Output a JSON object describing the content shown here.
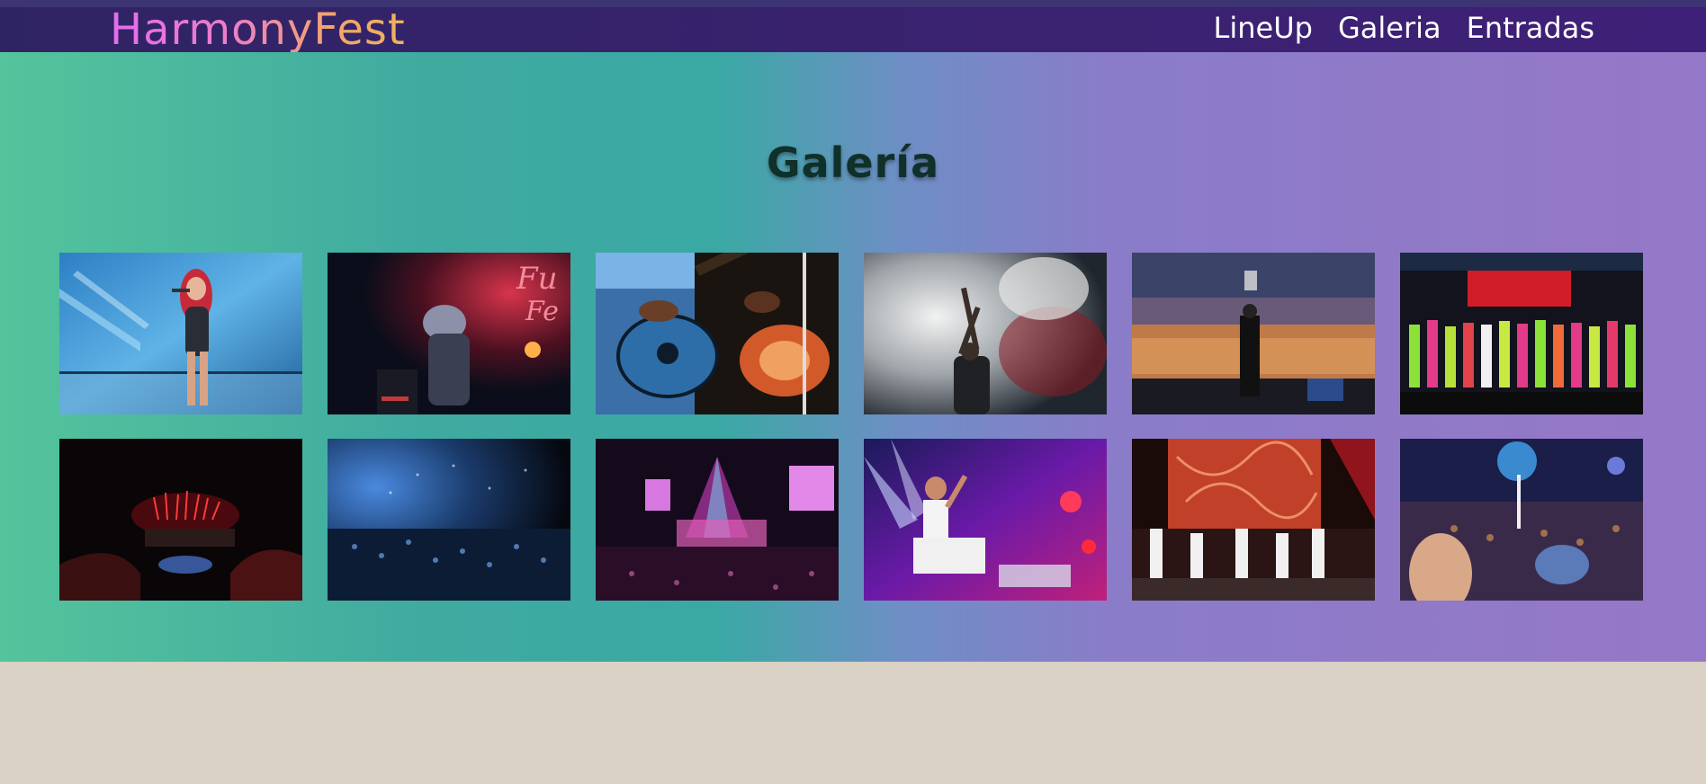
{
  "navbar": {
    "logo": "HarmonyFest",
    "links": [
      "LineUp",
      "Galeria",
      "Entradas"
    ]
  },
  "gallery": {
    "title": "Galería",
    "photos": [
      "singer-red-hair-photo",
      "singer-dark-stage-photo",
      "guitarists-photo",
      "smoke-performer-photo",
      "stadium-crowd-photo",
      "dancers-stage-photo",
      "fireworks-stage-photo",
      "blue-crowd-photo",
      "pink-lights-stage-photo",
      "singer-purple-lights-photo",
      "fire-screen-band-photo",
      "planet-stage-photo"
    ]
  },
  "colors": {
    "navbar": "#2f2463",
    "hero_left": "#54c49c",
    "hero_right": "#9678c8",
    "footer": "#d9d1c4",
    "logo_start": "#e46cf0",
    "logo_end": "#f0b15e"
  }
}
